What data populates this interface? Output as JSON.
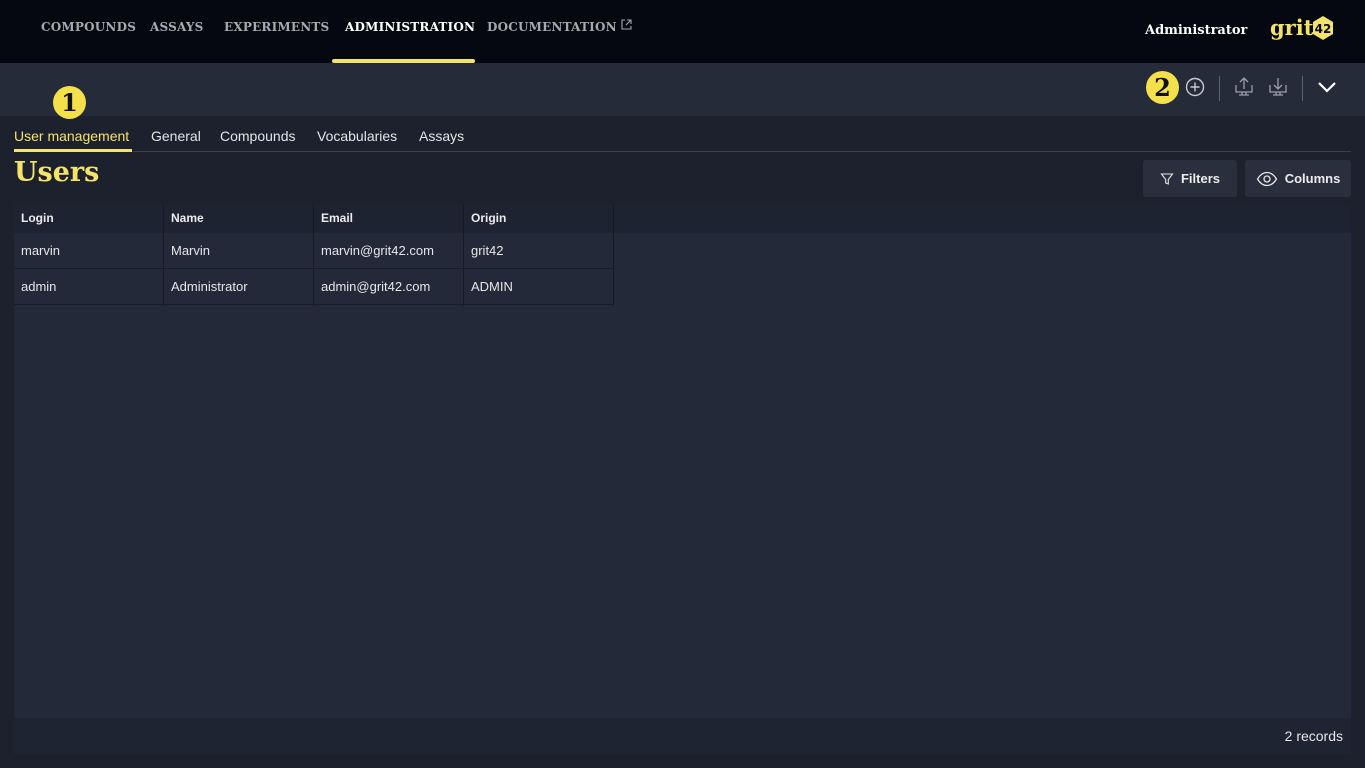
{
  "topnav": {
    "items": [
      {
        "label": "COMPOUNDS"
      },
      {
        "label": "ASSAYS"
      },
      {
        "label": "EXPERIMENTS"
      },
      {
        "label": "ADMINISTRATION",
        "active": true
      },
      {
        "label": "DOCUMENTATION",
        "external": true
      }
    ],
    "user": "Administrator",
    "logo_text": "grit42"
  },
  "toolbar": {
    "badges": [
      "1",
      "2"
    ],
    "icons": [
      "add-circle-icon",
      "upload-icon",
      "download-icon",
      "chevron-down-icon"
    ]
  },
  "subtabs": [
    {
      "label": "User management",
      "active": true
    },
    {
      "label": "General"
    },
    {
      "label": "Compounds"
    },
    {
      "label": "Vocabularies"
    },
    {
      "label": "Assays"
    }
  ],
  "page": {
    "title": "Users",
    "filters_label": "Filters",
    "columns_label": "Columns"
  },
  "table": {
    "columns": [
      "Login",
      "Name",
      "Email",
      "Origin"
    ],
    "rows": [
      [
        "marvin",
        "Marvin",
        "marvin@grit42.com",
        "grit42"
      ],
      [
        "admin",
        "Administrator",
        "admin@grit42.com",
        "ADMIN"
      ]
    ],
    "footer": "2 records"
  },
  "colors": {
    "accent": "#f3e36b",
    "nav_bg": "#050711",
    "toolbar_bg": "#262b3a",
    "page_bg": "#1c212d"
  }
}
